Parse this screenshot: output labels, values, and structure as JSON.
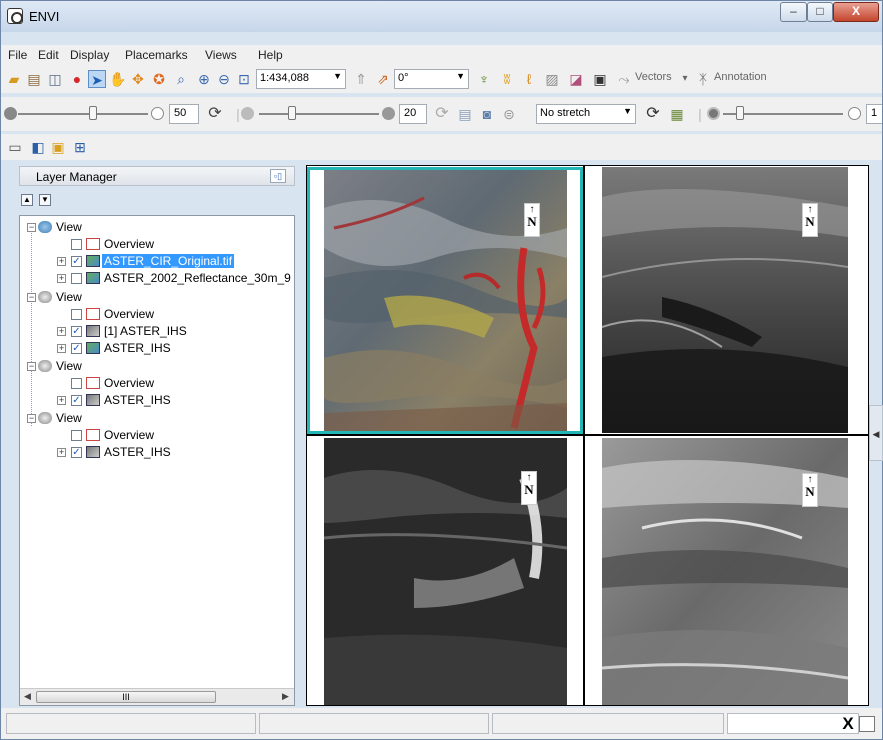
{
  "window": {
    "title": "ENVI",
    "min_label": "–",
    "max_label": "□",
    "close_label": "X"
  },
  "menu": [
    "File",
    "Edit",
    "Display",
    "Placemarks",
    "Views",
    "Help"
  ],
  "toolbar1": {
    "scale_value": "1:434,088",
    "rotation_value": "0°",
    "vectors_label": "Vectors",
    "annotations_label": "Annotation"
  },
  "toolbar2": {
    "brightness_value": "50",
    "contrast_value": "20",
    "stretch_value": "No stretch",
    "sharpen_value": "1"
  },
  "layer_manager": {
    "title": "Layer Manager",
    "tree": [
      {
        "type": "view",
        "label": "View"
      },
      {
        "type": "overview",
        "label": "Overview"
      },
      {
        "type": "layer",
        "label": "ASTER_CIR_Original.tif",
        "checked": true,
        "selected": true
      },
      {
        "type": "layer",
        "label": "ASTER_2002_Reflectance_30m_9",
        "checked": false
      },
      {
        "type": "view",
        "label": "View"
      },
      {
        "type": "overview",
        "label": "Overview"
      },
      {
        "type": "gray",
        "label": "[1] ASTER_IHS",
        "checked": true
      },
      {
        "type": "layer",
        "label": "ASTER_IHS",
        "checked": true
      },
      {
        "type": "view",
        "label": "View"
      },
      {
        "type": "overview",
        "label": "Overview"
      },
      {
        "type": "gray",
        "label": "ASTER_IHS",
        "checked": true
      },
      {
        "type": "view",
        "label": "View"
      },
      {
        "type": "overview",
        "label": "Overview"
      },
      {
        "type": "gray",
        "label": "ASTER_IHS",
        "checked": true
      }
    ],
    "scroll_label": "III"
  },
  "views": {
    "north_label": "N",
    "north_arrow": "↑"
  },
  "statusbar": {
    "close_label": "X"
  }
}
